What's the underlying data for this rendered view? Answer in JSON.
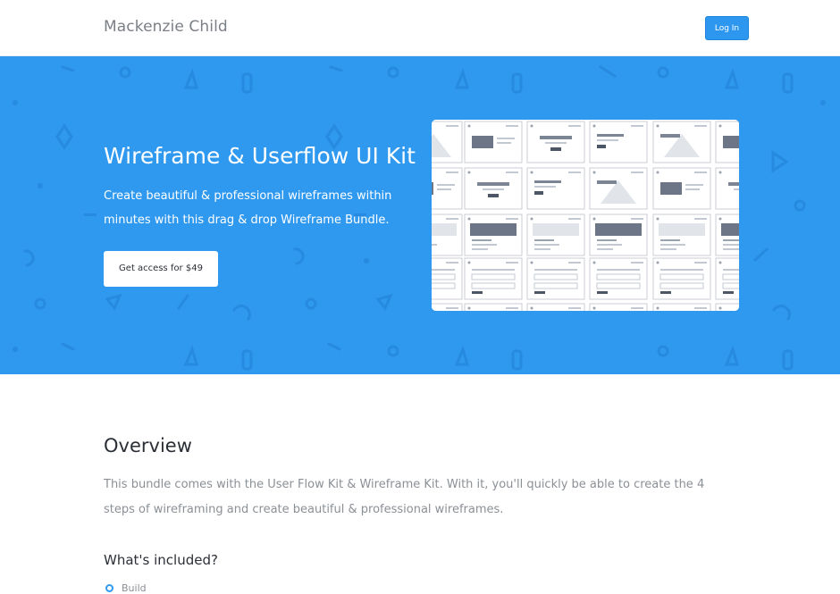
{
  "header": {
    "brand": "Mackenzie Child",
    "login_label": "Log In"
  },
  "hero": {
    "title": "Wireframe & Userflow UI Kit",
    "subtitle": "Create beautiful & professional wireframes within minutes with this drag & drop Wireframe Bundle.",
    "cta_label": "Get access for $49",
    "preview_alt": "wireframe-kit-preview"
  },
  "overview": {
    "title": "Overview",
    "text": "This bundle comes with the User Flow Kit & Wireframe Kit. With it, you'll quickly be able to create the 4 steps of wireframing and create beautiful & professional wireframes."
  },
  "included": {
    "title": "What's included?",
    "first_item": "Build"
  },
  "colors": {
    "accent": "#2f98ef",
    "hero_bg": "#2f98ef",
    "text_dark": "#2b2f36",
    "text_muted": "#8b9096"
  }
}
